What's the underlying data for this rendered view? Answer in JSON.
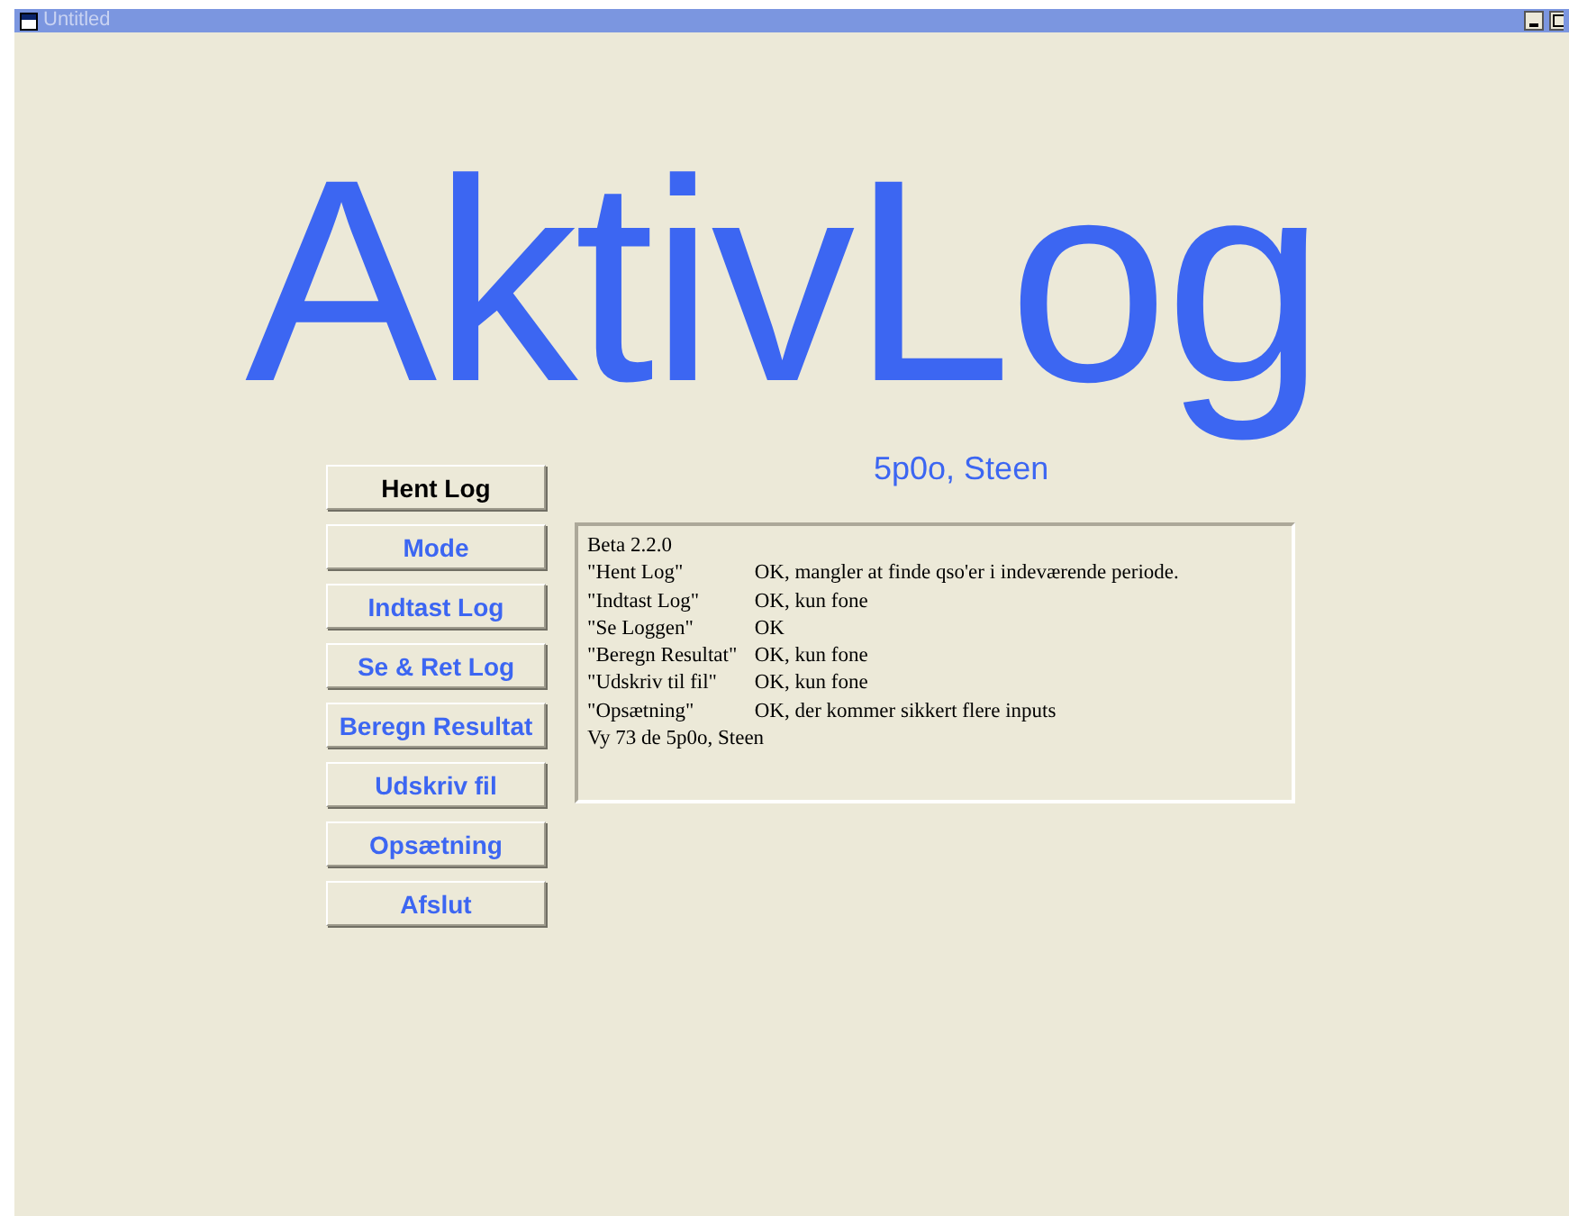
{
  "window": {
    "title": "Untitled"
  },
  "app_title": "AktivLog",
  "subtitle": "5p0o, Steen",
  "buttons": [
    {
      "label": "Hent Log",
      "selected": true
    },
    {
      "label": "Mode",
      "selected": false
    },
    {
      "label": "Indtast Log",
      "selected": false
    },
    {
      "label": "Se & Ret Log",
      "selected": false
    },
    {
      "label": "Beregn Resultat",
      "selected": false
    },
    {
      "label": "Udskriv fil",
      "selected": false
    },
    {
      "label": "Opsætning",
      "selected": false
    },
    {
      "label": "Afslut",
      "selected": false
    }
  ],
  "notes": [
    {
      "kind": "plain",
      "text": "Beta 2.2.0"
    },
    {
      "kind": "pair",
      "label": "\"Hent Log\"",
      "status": "OK, mangler at finde qso'er i indeværende periode."
    },
    {
      "kind": "pair",
      "label": "\"Indtast Log\"",
      "status": "OK, kun fone"
    },
    {
      "kind": "pair",
      "label": "\"Se Loggen\"",
      "status": "OK"
    },
    {
      "kind": "pair",
      "label": "\"Beregn Resultat\"",
      "status": "OK, kun fone"
    },
    {
      "kind": "pair",
      "label": "\"Udskriv til fil\"",
      "status": "OK, kun fone"
    },
    {
      "kind": "pair",
      "label": "\"Opsætning\"",
      "status": "OK, der kommer sikkert flere inputs"
    },
    {
      "kind": "plain",
      "text": "Vy 73 de 5p0o, Steen"
    }
  ]
}
